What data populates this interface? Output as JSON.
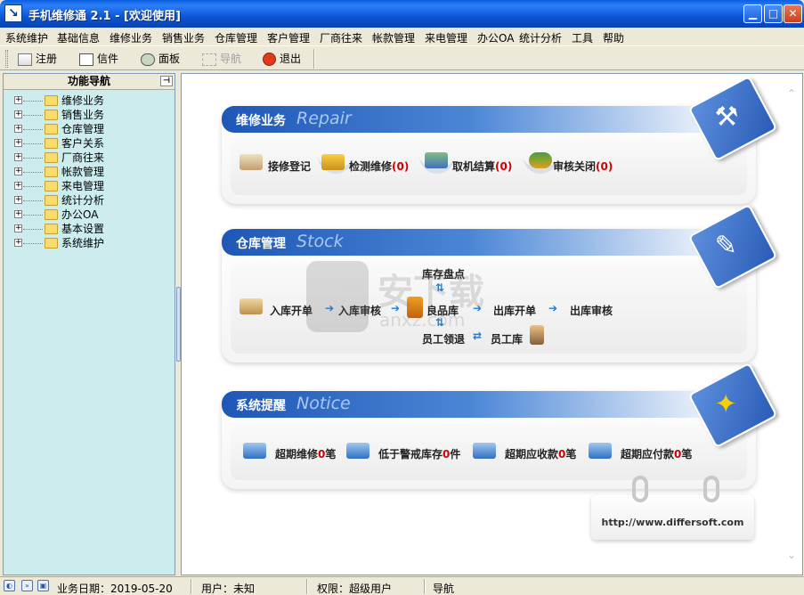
{
  "window": {
    "title": "手机维修通 2.1 - [欢迎使用]",
    "controls": [
      "minimize",
      "maximize",
      "close"
    ]
  },
  "menu": [
    "系统维护",
    "基础信息",
    "维修业务",
    "销售业务",
    "仓库管理",
    "客户管理",
    "厂商往来",
    "帐款管理",
    "来电管理",
    "办公OA",
    "统计分析",
    "工具",
    "帮助"
  ],
  "toolbar": {
    "register": "注册",
    "mail": "信件",
    "panel": "面板",
    "navigate": "导航",
    "exit": "退出"
  },
  "nav": {
    "title": "功能导航",
    "items": [
      "维修业务",
      "销售业务",
      "仓库管理",
      "客户关系",
      "厂商往来",
      "帐款管理",
      "来电管理",
      "统计分析",
      "办公OA",
      "基本设置",
      "系统维护"
    ]
  },
  "repair": {
    "title_cn": "维修业务",
    "title_en": "Repair",
    "items": [
      {
        "label": "接修登记",
        "count": ""
      },
      {
        "label": "检测维修",
        "count": "(0)"
      },
      {
        "label": "取机结算",
        "count": "(0)"
      },
      {
        "label": "审核关闭",
        "count": "(0)"
      }
    ]
  },
  "stock": {
    "title_cn": "仓库管理",
    "title_en": "Stock",
    "inbound": "入库开单",
    "inbound_review": "入库审核",
    "good_store": "良品库",
    "outbound": "出库开单",
    "outbound_review": "出库审核",
    "inventory": "库存盘点",
    "staff_return": "员工领退",
    "staff_store": "员工库"
  },
  "notice": {
    "title_cn": "系统提醒",
    "title_en": "Notice",
    "items": [
      {
        "pre": "超期维修",
        "count": "0",
        "post": "笔"
      },
      {
        "pre": "低于警戒库存",
        "count": "0",
        "post": "件"
      },
      {
        "pre": "超期应收款",
        "count": "0",
        "post": "笔"
      },
      {
        "pre": "超期应付款",
        "count": "0",
        "post": "笔"
      }
    ]
  },
  "website": "http://www.differsoft.com",
  "watermark": {
    "text": "安下载",
    "sub": "anxz.com"
  },
  "status": {
    "date_label": "业务日期：",
    "date": "2019-05-20",
    "user_label": "用户：",
    "user": "未知",
    "perm_label": "权限：",
    "perm": "超级用户",
    "mode": "导航"
  }
}
